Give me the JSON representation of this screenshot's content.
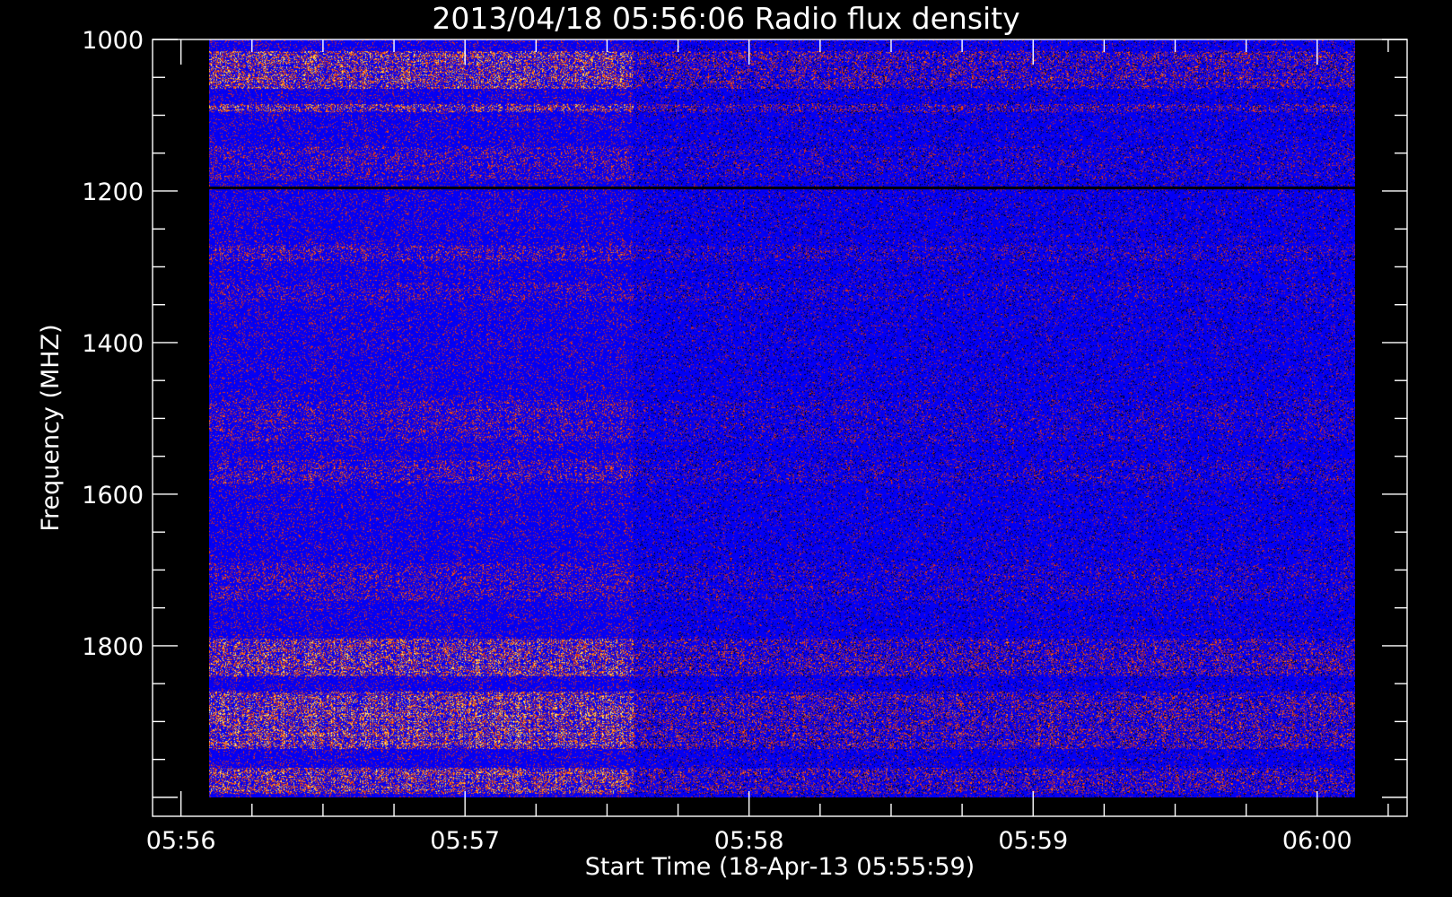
{
  "chart_data": {
    "type": "heatmap",
    "title": "2013/04/18 05:56:06 Radio flux density",
    "xlabel": "Start Time (18‐Apr‐13 05:55:59)",
    "ylabel": "Frequency (MHZ)",
    "x_axis": {
      "unit": "UT",
      "range": [
        "05:55:54",
        "06:00:19"
      ],
      "major_ticks": [
        "05:56",
        "05:57",
        "05:58",
        "05:59",
        "06:00"
      ],
      "minor_ticks_per_major": 3
    },
    "y_axis": {
      "unit": "MHz",
      "range": [
        1000,
        2025
      ],
      "inverted": true,
      "major_ticks": [
        "1000",
        "1200",
        "1400",
        "1600",
        "1800"
      ],
      "minor_step": 50
    },
    "data_extent": {
      "time_start": "05:56:06",
      "time_end": "06:00:08",
      "freq_min": 1000,
      "freq_max": 2000
    },
    "colors": {
      "background": "#000000",
      "frame": "#ffffff",
      "colormap": [
        "#000000",
        "#0000ff",
        "#b0142a",
        "#ff4a00",
        "#ffe14a",
        "#ffffff"
      ]
    },
    "features": [
      {
        "type": "band",
        "freq_range": [
          1015,
          1065
        ],
        "intensity": 0.85
      },
      {
        "type": "band",
        "freq_range": [
          1085,
          1095
        ],
        "intensity": 0.8
      },
      {
        "type": "band",
        "freq_range": [
          1140,
          1185
        ],
        "intensity": 0.45
      },
      {
        "type": "band",
        "freq_range": [
          1270,
          1292
        ],
        "intensity": 0.5
      },
      {
        "type": "band",
        "freq_range": [
          1320,
          1345
        ],
        "intensity": 0.4
      },
      {
        "type": "band",
        "freq_range": [
          1475,
          1530
        ],
        "intensity": 0.45
      },
      {
        "type": "band",
        "freq_range": [
          1555,
          1585
        ],
        "intensity": 0.5
      },
      {
        "type": "band",
        "freq_range": [
          1690,
          1740
        ],
        "intensity": 0.45
      },
      {
        "type": "band",
        "freq_range": [
          1790,
          1840
        ],
        "intensity": 0.8
      },
      {
        "type": "band",
        "freq_range": [
          1860,
          1935
        ],
        "intensity": 0.9
      },
      {
        "type": "band",
        "freq_range": [
          1960,
          1995
        ],
        "intensity": 0.85
      },
      {
        "type": "line",
        "freq": 1195,
        "intensity": 0.0
      }
    ],
    "grid": false,
    "legend": "none"
  }
}
